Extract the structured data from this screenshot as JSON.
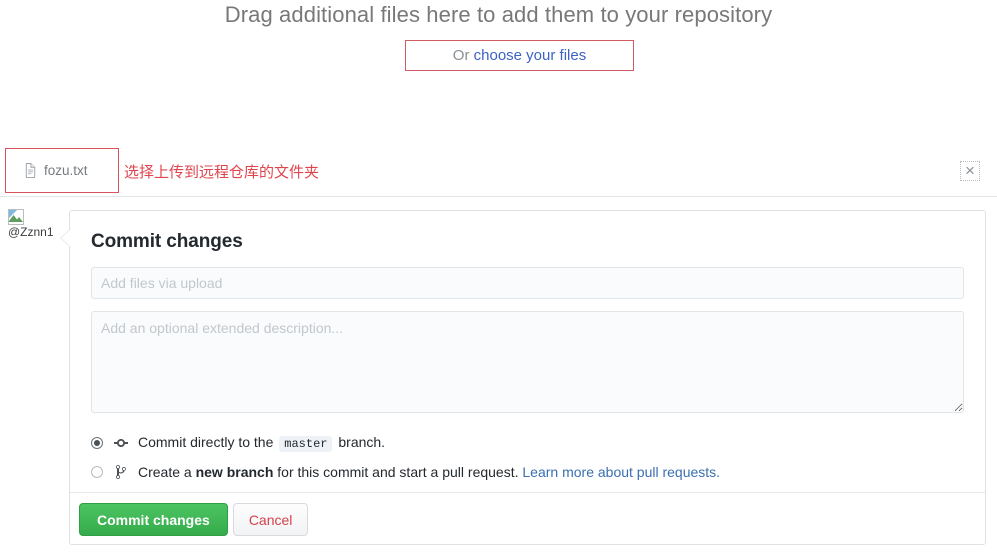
{
  "dropzone": {
    "title": "Drag additional files here to add them to your repository",
    "or_label": "Or ",
    "choose_link": "choose your files"
  },
  "file_row": {
    "file_icon": "file-icon",
    "file_name": "fozu.txt",
    "annotation": "选择上传到远程仓库的文件夹",
    "close_icon": "×"
  },
  "avatar": {
    "broken_image_icon": "broken-image-icon",
    "alt_text": "@Zznn1"
  },
  "commit": {
    "title": "Commit changes",
    "summary_value": "",
    "summary_placeholder": "Add files via upload",
    "description_value": "",
    "description_placeholder": "Add an optional extended description...",
    "options": [
      {
        "selected": true,
        "icon": "git-commit-icon",
        "text_before": "Commit directly to the",
        "branch": "master",
        "text_after": "branch."
      },
      {
        "selected": false,
        "icon": "git-branch-icon",
        "text_before": "Create a",
        "emphasis": "new branch",
        "text_after": " for this commit and start a pull request. ",
        "link": "Learn more about pull requests."
      }
    ],
    "commit_button": "Commit changes",
    "cancel_button": "Cancel"
  },
  "colors": {
    "annotation_red": "#e0454f",
    "link_blue": "#3a6fb0",
    "commit_green": "#35ab4b",
    "cancel_red": "#d6414d"
  }
}
